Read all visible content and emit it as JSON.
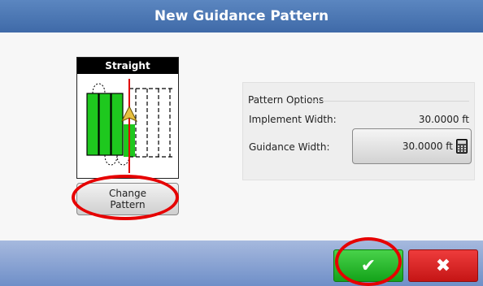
{
  "window": {
    "title": "New Guidance Pattern"
  },
  "pattern": {
    "name": "Straight",
    "change_label_line1": "Change",
    "change_label_line2": "Pattern"
  },
  "options": {
    "legend": "Pattern Options",
    "implement_width_label": "Implement Width:",
    "implement_width_value": "30.0000 ft",
    "guidance_width_label": "Guidance Width:",
    "guidance_width_value": "30.0000 ft"
  },
  "actions": {
    "accept_glyph": "✔",
    "cancel_glyph": "✖"
  },
  "colors": {
    "title_bar": "#4a77b5",
    "accept": "#22b026",
    "cancel": "#dd2323",
    "highlight_ring": "#e60000",
    "coverage": "#1ec81e"
  },
  "icons": {
    "accept": "checkmark-icon",
    "cancel": "x-icon",
    "calculator": "calculator-icon",
    "vehicle": "vehicle-arrow-icon"
  }
}
